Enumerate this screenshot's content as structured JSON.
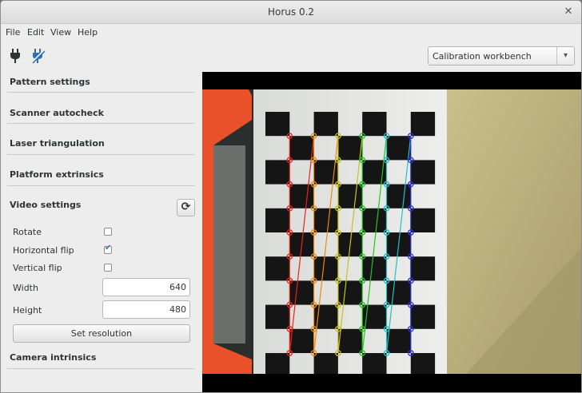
{
  "window": {
    "title": "Horus 0.2",
    "close_glyph": "✕"
  },
  "menubar": {
    "items": [
      "File",
      "Edit",
      "View",
      "Help"
    ]
  },
  "toolbar": {
    "connect_icon": "plug-icon",
    "disconnect_icon": "plug-disconnect-icon",
    "workbench_value": "Calibration workbench",
    "workbench_arrow": "▾"
  },
  "panel": {
    "sections": {
      "pattern": "Pattern settings",
      "autocheck": "Scanner autocheck",
      "laser": "Laser triangulation",
      "platform": "Platform extrinsics",
      "video": "Video settings",
      "camera": "Camera intrinsics"
    },
    "video_settings": {
      "refresh_glyph": "⟳",
      "rotate_label": "Rotate",
      "rotate_checked": false,
      "hflip_label": "Horizontal flip",
      "hflip_checked": true,
      "vflip_label": "Vertical flip",
      "vflip_checked": false,
      "width_label": "Width",
      "width_value": "640",
      "height_label": "Height",
      "height_value": "480",
      "set_resolution_label": "Set resolution"
    }
  },
  "camera_view": {
    "pattern_rows": 11,
    "pattern_cols": 7,
    "corner_colors": [
      "#e8231b",
      "#e88a12",
      "#c8c21a",
      "#24c420",
      "#1fc2c8",
      "#2830e0"
    ]
  }
}
